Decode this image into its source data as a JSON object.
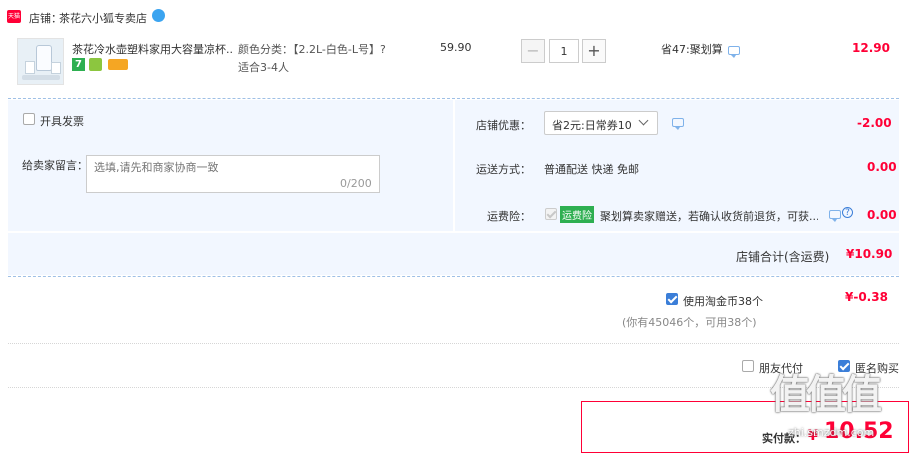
{
  "shop": {
    "badge_label": "天猫",
    "prefix": "店铺：",
    "name": "茶花六小狐专卖店"
  },
  "item": {
    "title": "茶花冷水壶塑料家用大容量凉杯...",
    "attr_text": "颜色分类：【2.2L-白色-L号】?",
    "attr_text_2": "适合3-4人",
    "price": "59.90",
    "quantity": "1",
    "minus_label": "−",
    "plus_label": "+",
    "promo": "省47:聚划算",
    "subtotal": "12.90",
    "badge_7": "7"
  },
  "invoice": {
    "label": "开具发票"
  },
  "message": {
    "label": "给卖家留言：",
    "placeholder": "选填,请先和商家协商一致",
    "counter": "0/200"
  },
  "shop_discount": {
    "label": "店铺优惠：",
    "selected": "省2元:日常券10",
    "amount": "-2.00"
  },
  "shipping": {
    "label": "运送方式：",
    "value": "普通配送 快递 免邮",
    "amount": "0.00"
  },
  "insurance": {
    "label": "运费险：",
    "badge": "运费险",
    "text": "聚划算卖家赠送，若确认收货前退货，可获...",
    "amount": "0.00"
  },
  "shop_total": {
    "label": "店铺合计(含运费)",
    "amount": "¥10.90"
  },
  "coins": {
    "label": "使用淘金币38个",
    "note": "(你有45046个，可用38个)",
    "amount": "¥-0.38"
  },
  "options": {
    "friend_pay": "朋友代付",
    "anonymous": "匿名购买"
  },
  "pay": {
    "label": "实付款：",
    "currency": "¥",
    "amount": "10.52"
  },
  "watermark": {
    "glyphs": "值值值",
    "site": "zhi.smzdm.com"
  },
  "colors": {
    "accent": "#ff0036",
    "link": "#3b7ed8",
    "panel_bg": "#f2f7ff"
  }
}
